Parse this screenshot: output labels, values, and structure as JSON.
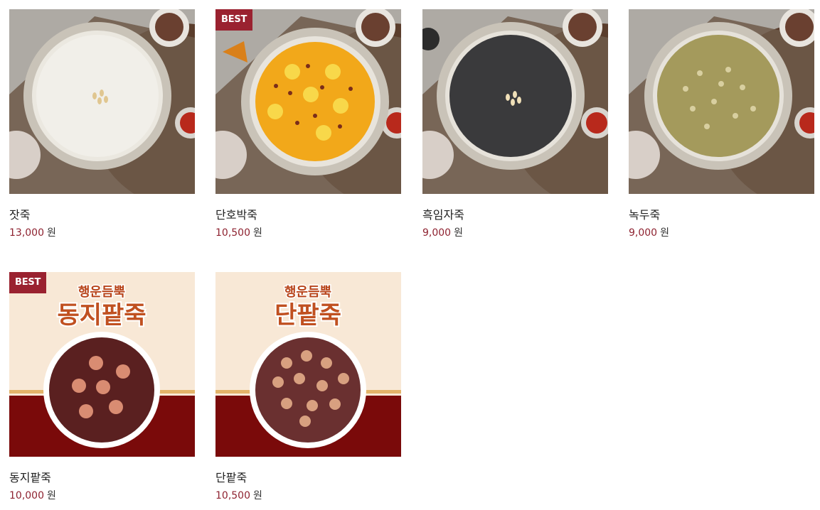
{
  "colors": {
    "accent": "#9a2230",
    "price": "#8e2230",
    "banner_red": "#7a0a0a",
    "banner_cream": "#f8e8d6"
  },
  "products": [
    {
      "name": "잣죽",
      "price": "13,000",
      "unit": "원",
      "badge": "",
      "image": "pine-nut-porridge-image"
    },
    {
      "name": "단호박죽",
      "price": "10,500",
      "unit": "원",
      "badge": "BEST",
      "image": "pumpkin-porridge-image"
    },
    {
      "name": "흑임자죽",
      "price": "9,000",
      "unit": "원",
      "badge": "",
      "image": "black-sesame-porridge-image"
    },
    {
      "name": "녹두죽",
      "price": "9,000",
      "unit": "원",
      "badge": "",
      "image": "mung-bean-porridge-image"
    },
    {
      "name": "동지팥죽",
      "price": "10,000",
      "unit": "원",
      "badge": "BEST",
      "image": "dongji-red-bean-porridge-image",
      "banner_top": "행운듬뿍",
      "banner_title": "동지팥죽"
    },
    {
      "name": "단팥죽",
      "price": "10,500",
      "unit": "원",
      "badge": "",
      "image": "sweet-red-bean-porridge-image",
      "banner_top": "행운듬뿍",
      "banner_title": "단팥죽"
    }
  ]
}
